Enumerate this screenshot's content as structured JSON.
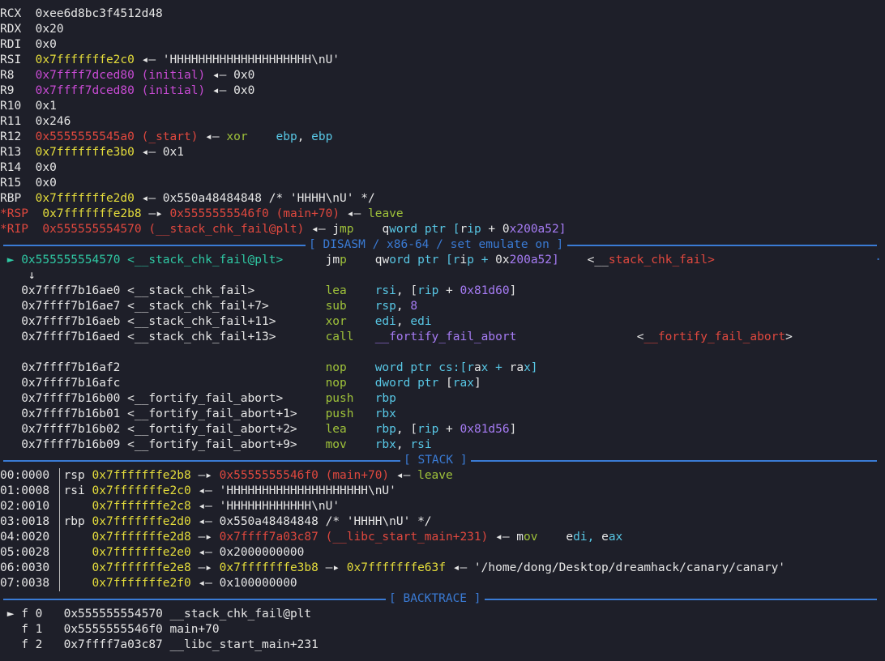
{
  "colors": {
    "background": "#1e1f29",
    "white": "#e6e6e6",
    "yellow": "#e5dd3b",
    "red": "#e0483e",
    "magenta": "#c84bd4",
    "green": "#9fc23a",
    "cyan": "#58c7e5",
    "purple": "#a77cf5",
    "teal": "#2fc9a4",
    "separator": "#3a7bd5"
  },
  "registers": [
    {
      "text": "RCX  0xee6d8bc3f4512d48"
    },
    {
      "text": "RDX  0x20"
    },
    {
      "text": "RDI  0x0"
    },
    {
      "text": "RSI  0x7fffffffe2c0 ◂— 'HHHHHHHHHHHHHHHHHHHH\\nU'"
    },
    {
      "text": "R8   0x7ffff7dced80 (initial) ◂— 0x0"
    },
    {
      "text": "R9   0x7ffff7dced80 (initial) ◂— 0x0"
    },
    {
      "text": "R10  0x1"
    },
    {
      "text": "R11  0x246"
    },
    {
      "text": "R12  0x5555555545a0 (_start) ◂— xor    ebp, ebp"
    },
    {
      "text": "R13  0x7fffffffe3b0 ◂— 0x1"
    },
    {
      "text": "R14  0x0"
    },
    {
      "text": "R15  0x0"
    },
    {
      "text": "RBP  0x7fffffffe2d0 ◂— 0x550a48484848 /* 'HHHH\\nU' */"
    },
    {
      "text": "*RSP  0x7fffffffe2b8 —▸ 0x5555555546f0 (main+70) ◂— leave"
    },
    {
      "text": "*RIP  0x555555554570 (__stack_chk_fail@plt) ◂— jmp    qword ptr [rip + 0x200a52]"
    }
  ],
  "sections": {
    "disasm": "[ DISASM / x86-64 / set emulate on ]",
    "stack": "[ STACK ]",
    "backtrace": "[ BACKTRACE ]",
    "more_indicator": "·"
  },
  "disasm": [
    {
      "text": " ► 0x555555554570 <__stack_chk_fail@plt>      jmp    qword ptr [rip + 0x200a52]    <__stack_chk_fail>"
    },
    {
      "text": "    ↓"
    },
    {
      "text": "   0x7ffff7b16ae0 <__stack_chk_fail>          lea    rsi, [rip + 0x81d60]"
    },
    {
      "text": "   0x7ffff7b16ae7 <__stack_chk_fail+7>        sub    rsp, 8"
    },
    {
      "text": "   0x7ffff7b16aeb <__stack_chk_fail+11>       xor    edi, edi"
    },
    {
      "text": "   0x7ffff7b16aed <__stack_chk_fail+13>       call   __fortify_fail_abort                 <__fortify_fail_abort>"
    },
    {
      "text": ""
    },
    {
      "text": "   0x7ffff7b16af2                             nop    word ptr cs:[rax + rax]"
    },
    {
      "text": "   0x7ffff7b16afc                             nop    dword ptr [rax]"
    },
    {
      "text": "   0x7ffff7b16b00 <__fortify_fail_abort>      push   rbp"
    },
    {
      "text": "   0x7ffff7b16b01 <__fortify_fail_abort+1>    push   rbx"
    },
    {
      "text": "   0x7ffff7b16b02 <__fortify_fail_abort+2>    lea    rbp, [rip + 0x81d56]"
    },
    {
      "text": "   0x7ffff7b16b09 <__fortify_fail_abort+9>    mov    rbx, rsi"
    }
  ],
  "stack": [
    {
      "text": "00:0000  rsp 0x7fffffffe2b8 —▸ 0x5555555546f0 (main+70) ◂— leave"
    },
    {
      "text": "01:0008  rsi 0x7fffffffe2c0 ◂— 'HHHHHHHHHHHHHHHHHHHH\\nU'"
    },
    {
      "text": "02:0010      0x7fffffffe2c8 ◂— 'HHHHHHHHHHHH\\nU'"
    },
    {
      "text": "03:0018  rbp 0x7fffffffe2d0 ◂— 0x550a48484848 /* 'HHHH\\nU' */"
    },
    {
      "text": "04:0020      0x7fffffffe2d8 —▸ 0x7ffff7a03c87 (__libc_start_main+231) ◂— mov    edi, eax"
    },
    {
      "text": "05:0028      0x7fffffffe2e0 ◂— 0x2000000000"
    },
    {
      "text": "06:0030      0x7fffffffe2e8 —▸ 0x7fffffffe3b8 —▸ 0x7fffffffe63f ◂— '/home/dong/Desktop/dreamhack/canary/canary'"
    },
    {
      "text": "07:0038      0x7fffffffe2f0 ◂— 0x100000000"
    }
  ],
  "backtrace": [
    {
      "text": " ► f 0   0x555555554570 __stack_chk_fail@plt"
    },
    {
      "text": "   f 1   0x5555555546f0 main+70"
    },
    {
      "text": "   f 2   0x7ffff7a03c87 __libc_start_main+231"
    }
  ]
}
